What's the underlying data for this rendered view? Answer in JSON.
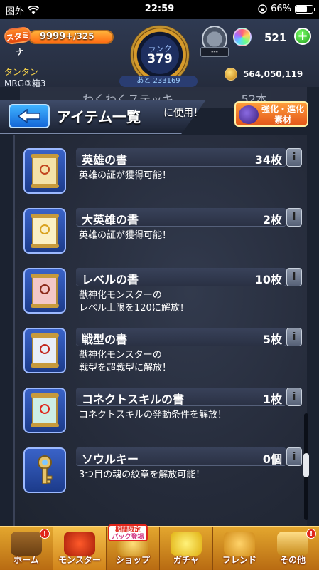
{
  "status_bar": {
    "carrier": "圏外",
    "time": "22:59",
    "battery": "66%"
  },
  "hud": {
    "stamina_label": "スタミナ",
    "stamina_value": "9999+",
    "stamina_max": "/325",
    "rank_label": "ランク",
    "rank_value": "379",
    "ticket_label": "---",
    "orb_count": "521",
    "orb_add": "+",
    "player_name": "タンタン",
    "player_stage": "MRG③箱3",
    "exp_remaining": "あと 233169",
    "coins": "564,050,119"
  },
  "list_header": {
    "peek_title": "わくわくステッキ",
    "peek_count": "52本",
    "title": "アイテム一覧",
    "note": "に使用！",
    "evolve_badge": "強化・進化素材"
  },
  "items": [
    {
      "name": "英雄の書",
      "count": "34枚",
      "desc": "英雄の証が獲得可能！",
      "icon": "hero-book-icon"
    },
    {
      "name": "大英雄の書",
      "count": "2枚",
      "desc": "英雄の証が獲得可能！",
      "icon": "great-hero-book-icon"
    },
    {
      "name": "レベルの書",
      "count": "10枚",
      "desc": "獣神化モンスターの\nレベル上限を120に解放！",
      "icon": "level-book-icon"
    },
    {
      "name": "戦型の書",
      "count": "5枚",
      "desc": "獣神化モンスターの\n戦型を超戦型に解放！",
      "icon": "battle-type-book-icon"
    },
    {
      "name": "コネクトスキルの書",
      "count": "1枚",
      "desc": "コネクトスキルの発動条件を解放！",
      "icon": "connect-skill-book-icon"
    },
    {
      "name": "ソウルキー",
      "count": "0個",
      "desc": "3つ目の魂の紋章を解放可能！",
      "icon": "soul-key-icon"
    }
  ],
  "info_label": "i",
  "bottom_nav": {
    "limited_badge_line1": "期間限定",
    "limited_badge_line2": "パック登場",
    "badge": "!",
    "items": [
      "ホーム",
      "モンスター",
      "ショップ",
      "ガチャ",
      "フレンド",
      "その他"
    ]
  },
  "colors": {
    "accent_orange": "#e3a62e",
    "accent_blue": "#1467d8",
    "panel": "#252b3a"
  }
}
